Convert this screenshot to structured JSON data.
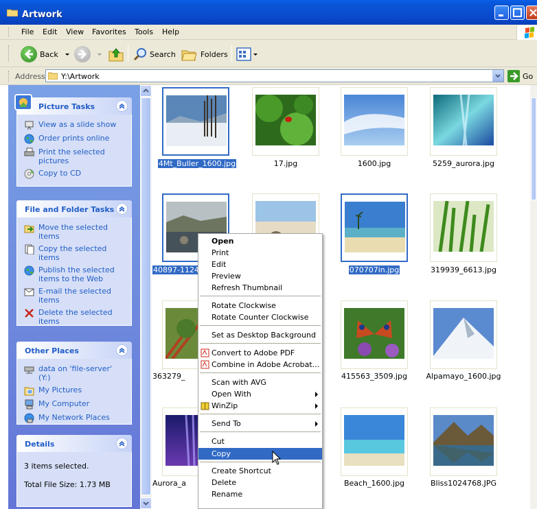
{
  "window": {
    "title": "Artwork"
  },
  "menu": [
    "File",
    "Edit",
    "View",
    "Favorites",
    "Tools",
    "Help"
  ],
  "toolbar": {
    "back": "Back",
    "search": "Search",
    "folders": "Folders"
  },
  "address": {
    "label": "Address",
    "value": "Y:\\Artwork",
    "go": "Go"
  },
  "tasks": {
    "picture": {
      "title": "Picture Tasks",
      "items": [
        "View as a slide show",
        "Order prints online",
        "Print the selected pictures",
        "Copy to CD"
      ]
    },
    "file": {
      "title": "File and Folder Tasks",
      "items": [
        "Move the selected items",
        "Copy the selected items",
        "Publish the selected items to the Web",
        "E-mail the selected items",
        "Delete the selected items"
      ]
    },
    "places": {
      "title": "Other Places",
      "items": [
        "data on 'file-server' (Y:)",
        "My Pictures",
        "My Computer",
        "My Network Places"
      ]
    },
    "details": {
      "title": "Details",
      "line1": "3 items selected.",
      "line2": "Total File Size: 1.73 MB"
    }
  },
  "files": [
    {
      "name": "4Mt_Buller_1600.jpg",
      "selected": true
    },
    {
      "name": "17.jpg",
      "selected": false
    },
    {
      "name": "1600.jpg",
      "selected": false
    },
    {
      "name": "5259_aurora.jpg",
      "selected": false
    },
    {
      "name": "40897-1124",
      "selected": true
    },
    {
      "name": "",
      "selected": false
    },
    {
      "name": "070707in.jpg",
      "selected": true
    },
    {
      "name": "319939_6613.jpg",
      "selected": false
    },
    {
      "name": "363279_",
      "selected": false
    },
    {
      "name": "",
      "selected": false
    },
    {
      "name": "415563_3509.jpg",
      "selected": false
    },
    {
      "name": "Alpamayo_1600.jpg",
      "selected": false
    },
    {
      "name": "Aurora_a",
      "selected": false
    },
    {
      "name": ".",
      "selected": false
    },
    {
      "name": "Beach_1600.jpg",
      "selected": false
    },
    {
      "name": "Bliss1024768.JPG",
      "selected": false
    }
  ],
  "context_menu": {
    "open": "Open",
    "print": "Print",
    "edit": "Edit",
    "preview": "Preview",
    "refresh": "Refresh Thumbnail",
    "rotate_cw": "Rotate Clockwise",
    "rotate_ccw": "Rotate Counter Clockwise",
    "desktop_bg": "Set as Desktop Background",
    "to_pdf": "Convert to Adobe PDF",
    "combine": "Combine in Adobe Acrobat...",
    "scan": "Scan with AVG",
    "open_with": "Open With",
    "winzip": "WinZip",
    "send_to": "Send To",
    "cut": "Cut",
    "copy": "Copy",
    "shortcut": "Create Shortcut",
    "delete": "Delete",
    "rename": "Rename"
  }
}
